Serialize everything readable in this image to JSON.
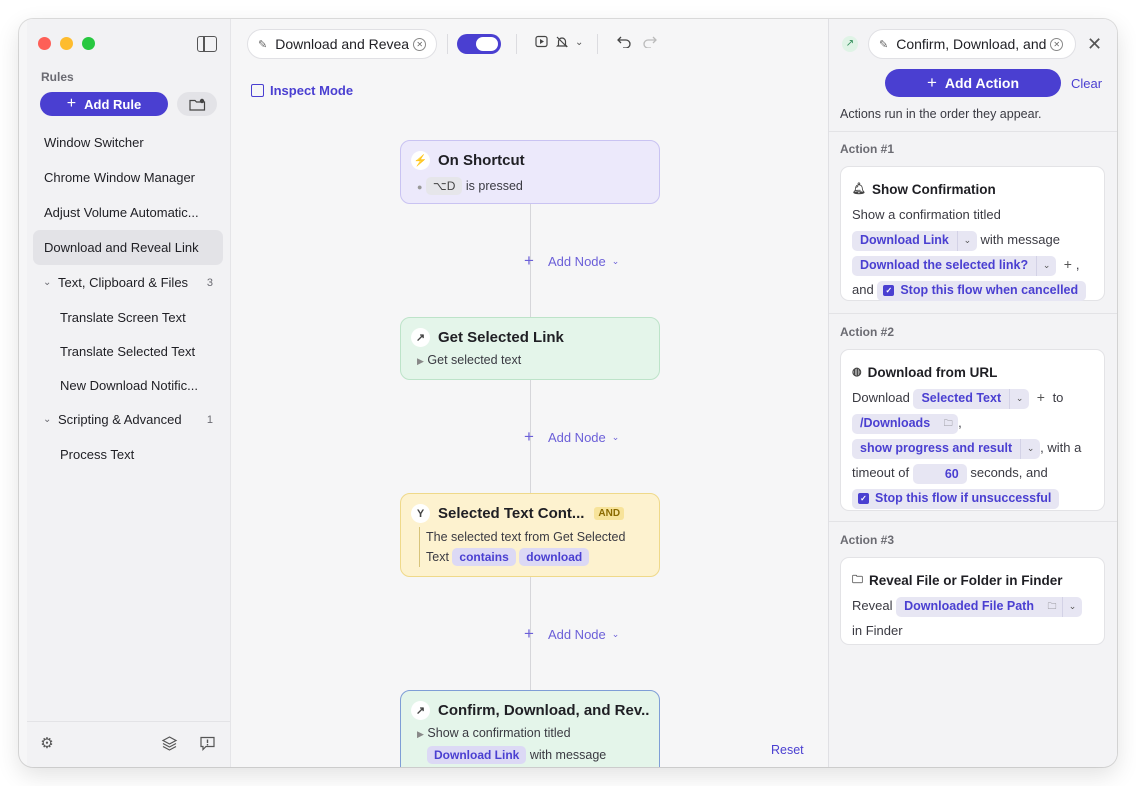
{
  "sidebar": {
    "heading": "Rules",
    "add_rule_label": "Add Rule",
    "rules": [
      "Window Switcher",
      "Chrome Window Manager",
      "Adjust Volume Automatic...",
      "Download and Reveal Link"
    ],
    "groups": [
      {
        "label": "Text, Clipboard & Files",
        "count": "3",
        "items": [
          "Translate Screen Text",
          "Translate Selected Text",
          "New Download Notific..."
        ]
      },
      {
        "label": "Scripting & Advanced",
        "count": "1",
        "items": [
          "Process Text"
        ]
      }
    ]
  },
  "toolbar": {
    "rule_title": "Download and Revea",
    "enabled": true
  },
  "canvas": {
    "inspect_mode_label": "Inspect Mode",
    "add_node_label": "Add Node",
    "reset_label": "Reset",
    "nodes": [
      {
        "title": "On Shortcut",
        "shortcut": "⌥D",
        "body": "is pressed",
        "icon": "lightning-icon"
      },
      {
        "title": "Get Selected Link",
        "body": "Get selected text",
        "icon": "arrow-up-right-icon"
      },
      {
        "title": "Selected Text Cont...",
        "badge": "AND",
        "body": "The selected text from Get Selected Text",
        "chip_contains": "contains",
        "chip_value": "download",
        "icon": "branch-icon"
      },
      {
        "title": "Confirm, Download, and Rev...",
        "body": "Show a confirmation titled",
        "chip": "Download Link",
        "body2": "with message",
        "icon": "arrow-up-right-icon"
      }
    ]
  },
  "panel": {
    "title": "Confirm, Download, and",
    "add_action_label": "Add Action",
    "clear_label": "Clear",
    "note": "Actions run in the order they appear.",
    "actions": [
      {
        "label": "Action #1",
        "title": "Show Confirmation",
        "text1": "Show a confirmation titled",
        "dd1": "Download Link",
        "text2": "with message",
        "dd2": "Download the selected link?",
        "text3": "and",
        "check": "Stop this flow when cancelled"
      },
      {
        "label": "Action #2",
        "title": "Download from URL",
        "text1": "Download",
        "dd1": "Selected Text",
        "text2": "to",
        "dd2": "/Downloads",
        "dd3": "show progress and result",
        "text3": ", with a timeout of",
        "timeout": "60",
        "text4": "seconds, and",
        "check": "Stop this flow if unsuccessful"
      },
      {
        "label": "Action #3",
        "title": "Reveal File or Folder in Finder",
        "text1": "Reveal",
        "dd1": "Downloaded File Path",
        "text2": "in Finder"
      }
    ]
  }
}
